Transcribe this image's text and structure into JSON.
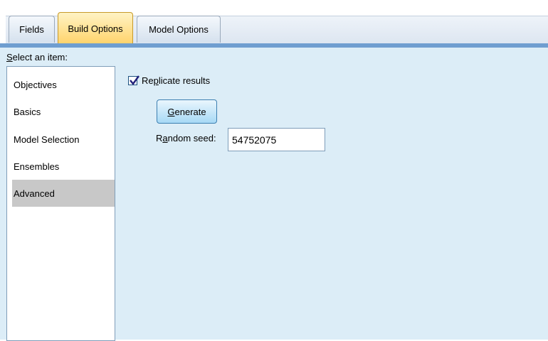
{
  "tabs": [
    {
      "label": "Fields",
      "active": false
    },
    {
      "label": "Build Options",
      "active": true
    },
    {
      "label": "Model Options",
      "active": false
    }
  ],
  "select_label": {
    "accel": "S",
    "rest": "elect an item:"
  },
  "items": [
    "Objectives",
    "Basics",
    "Model Selection",
    "Ensembles",
    "Advanced"
  ],
  "selected_item": "Advanced",
  "replicate": {
    "label_pre": "Re",
    "label_accel": "p",
    "label_post": "licate results",
    "checked": true
  },
  "generate": {
    "accel": "G",
    "rest": "enerate"
  },
  "seed": {
    "label_pre": "R",
    "label_accel": "a",
    "label_post": "ndom seed:",
    "value": "54752075"
  },
  "colors": {
    "active_tab": "#ffd36b",
    "panel_bg": "#dcedf7",
    "selected_item_bg": "#c8c8c8"
  }
}
